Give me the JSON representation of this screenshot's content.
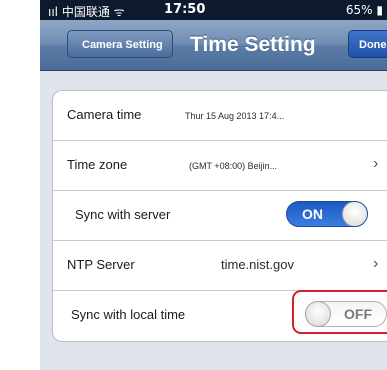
{
  "status_bar": {
    "carrier": "ııl 中国联通 ᯤ",
    "time": "17:50",
    "battery": "65% ▮"
  },
  "nav": {
    "back_label": "Camera Setting",
    "title": "Time Setting",
    "done_label": "Done"
  },
  "rows": {
    "camera_time": {
      "label": "Camera time",
      "value": "Thur 15 Aug 2013  17:4..."
    },
    "time_zone": {
      "label": "Time zone",
      "value": "(GMT +08:00) Beijin..."
    },
    "sync_server": {
      "label": "Sync with server",
      "switch_text": "ON",
      "state": "on"
    },
    "ntp_server": {
      "label": "NTP Server",
      "value": "time.nist.gov"
    },
    "sync_local": {
      "label": "Sync with local time",
      "switch_text": "OFF",
      "state": "off"
    }
  },
  "icons": {
    "chevron": "chevron-right-icon"
  },
  "colors": {
    "navbar": "#5b7ca6",
    "switch_on": "#2a6ad4",
    "highlight": "#d4202a",
    "background": "#dfe4ec"
  }
}
